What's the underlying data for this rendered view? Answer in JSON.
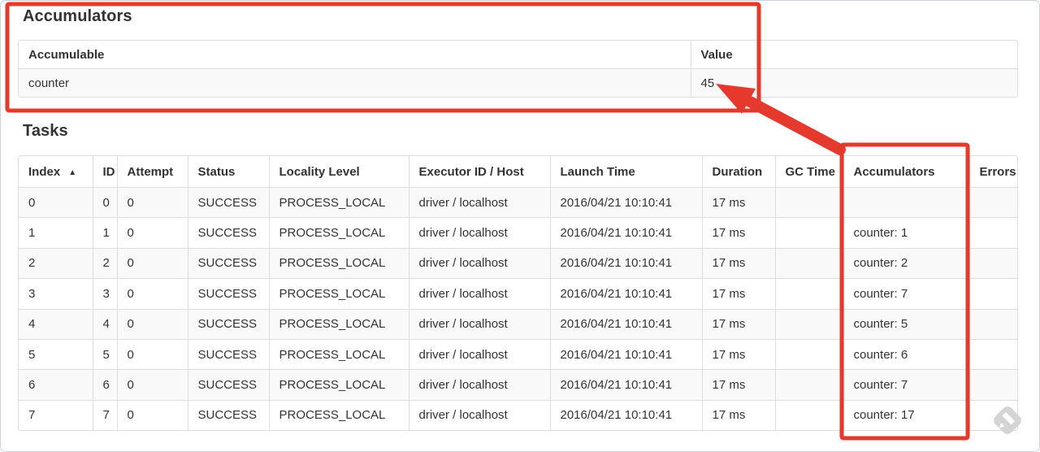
{
  "annotation_color": "#e5392e",
  "accumulators": {
    "title": "Accumulators",
    "headers": {
      "accumulable": "Accumulable",
      "value": "Value"
    },
    "rows": [
      {
        "accumulable": "counter",
        "value": "45"
      }
    ]
  },
  "tasks": {
    "title": "Tasks",
    "sort_icon": "▲",
    "headers": {
      "index": "Index",
      "id": "ID",
      "attempt": "Attempt",
      "status": "Status",
      "locality": "Locality Level",
      "executor": "Executor ID / Host",
      "launch": "Launch Time",
      "duration": "Duration",
      "gc": "GC Time",
      "accumulators": "Accumulators",
      "errors": "Errors"
    },
    "rows": [
      [
        "0",
        "0",
        "0",
        "SUCCESS",
        "PROCESS_LOCAL",
        "driver / localhost",
        "2016/04/21 10:10:41",
        "17 ms",
        "",
        "",
        ""
      ],
      [
        "1",
        "1",
        "0",
        "SUCCESS",
        "PROCESS_LOCAL",
        "driver / localhost",
        "2016/04/21 10:10:41",
        "17 ms",
        "",
        "counter: 1",
        ""
      ],
      [
        "2",
        "2",
        "0",
        "SUCCESS",
        "PROCESS_LOCAL",
        "driver / localhost",
        "2016/04/21 10:10:41",
        "17 ms",
        "",
        "counter: 2",
        ""
      ],
      [
        "3",
        "3",
        "0",
        "SUCCESS",
        "PROCESS_LOCAL",
        "driver / localhost",
        "2016/04/21 10:10:41",
        "17 ms",
        "",
        "counter: 7",
        ""
      ],
      [
        "4",
        "4",
        "0",
        "SUCCESS",
        "PROCESS_LOCAL",
        "driver / localhost",
        "2016/04/21 10:10:41",
        "17 ms",
        "",
        "counter: 5",
        ""
      ],
      [
        "5",
        "5",
        "0",
        "SUCCESS",
        "PROCESS_LOCAL",
        "driver / localhost",
        "2016/04/21 10:10:41",
        "17 ms",
        "",
        "counter: 6",
        ""
      ],
      [
        "6",
        "6",
        "0",
        "SUCCESS",
        "PROCESS_LOCAL",
        "driver / localhost",
        "2016/04/21 10:10:41",
        "17 ms",
        "",
        "counter: 7",
        ""
      ],
      [
        "7",
        "7",
        "0",
        "SUCCESS",
        "PROCESS_LOCAL",
        "driver / localhost",
        "2016/04/21 10:10:41",
        "17 ms",
        "",
        "counter: 17",
        ""
      ]
    ]
  }
}
